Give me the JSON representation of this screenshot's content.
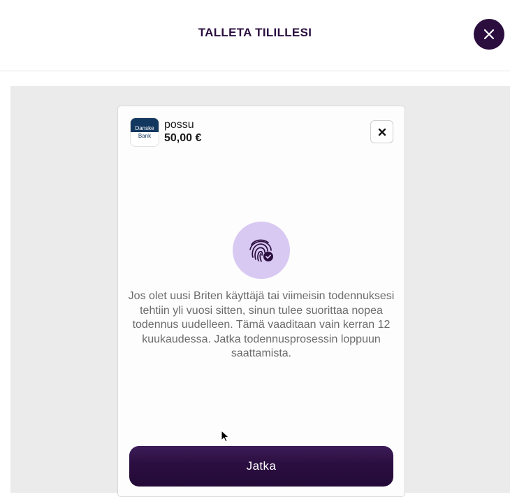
{
  "header": {
    "title": "TALLETA TILILLESI"
  },
  "bank": {
    "logo_line1": "Danske",
    "logo_line2": "Bank",
    "payee": "possu",
    "amount": "50,00 €"
  },
  "icons": {
    "main_close": "close-icon",
    "card_close": "close-icon",
    "fingerprint": "fingerprint-check-icon",
    "cursor": "mouse-pointer-icon"
  },
  "info": {
    "text": "Jos olet uusi Briten käyttäjä tai viimeisin todennuksesi tehtiin yli vuosi sitten, sinun tulee suorittaa nopea todennus uudelleen. Tämä vaaditaan vain kerran 12 kuukaudessa. Jatka todennusprosessin loppuun saattamista."
  },
  "actions": {
    "continue_label": "Jatka"
  },
  "colors": {
    "brand_dark": "#2b0e3e",
    "fingerprint_bg": "#d8c9f3",
    "bank_blue": "#13385f",
    "stage_bg": "#ebebeb"
  }
}
